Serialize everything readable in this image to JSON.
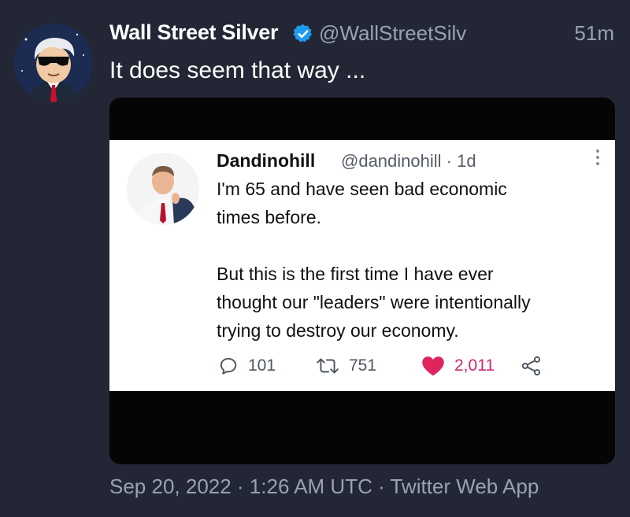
{
  "tweet": {
    "author_name": "Wall Street Silver",
    "handle": "@WallStreetSilv",
    "time_ago": "51m",
    "text": "It does seem that way ...",
    "footer": "Sep 20, 2022 · 1:26 AM UTC · Twitter Web App"
  },
  "quoted": {
    "name": "Dandinohill",
    "handle_time": "@dandinohill · 1d",
    "para1_line1": "I'm 65 and have seen bad economic",
    "para1_line2": "times before.",
    "para2_line1": "But this is the first time I have ever",
    "para2_line2": "thought our \"leaders\" were intentionally",
    "para2_line3": "trying to destroy our economy.",
    "replies": "101",
    "retweets": "751",
    "likes": "2,011"
  },
  "colors": {
    "background": "#232735",
    "secondary_text": "#9aa1b0",
    "verified": "#1d9bf0",
    "like": "#e0245e"
  },
  "icons": [
    "verified-badge-icon",
    "more-options-icon",
    "reply-icon",
    "retweet-icon",
    "heart-icon",
    "share-icon"
  ]
}
